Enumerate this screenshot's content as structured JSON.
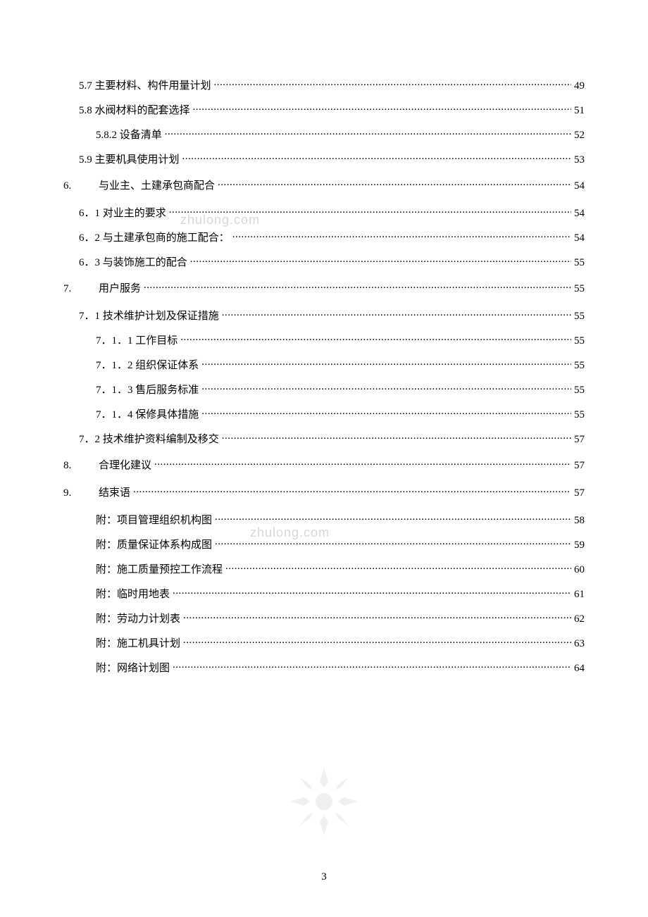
{
  "watermark": "zhulong.com",
  "pageNumber": "3",
  "toc": [
    {
      "level": 2,
      "label": "5.7 主要材料、构件用量计划 ",
      "page": "49"
    },
    {
      "level": 2,
      "label": "5.8 水阀材料的配套选择 ",
      "page": "51"
    },
    {
      "level": 3,
      "label": "5.8.2 设备清单 ",
      "page": "52"
    },
    {
      "level": 2,
      "label": "5.9 主要机具使用计划 ",
      "page": "53"
    },
    {
      "level": 1,
      "num": "6.",
      "label": "与业主、土建承包商配合",
      "page": "54"
    },
    {
      "level": 2,
      "label": "6．1 对业主的要求 ",
      "page": "54"
    },
    {
      "level": 2,
      "label": "6．2 与土建承包商的施工配合： ",
      "page": "54"
    },
    {
      "level": 2,
      "label": "6．3 与装饰施工的配合 ",
      "page": "55"
    },
    {
      "level": 1,
      "num": "7.",
      "label": "用户服务",
      "page": "55"
    },
    {
      "level": 2,
      "label": "7．1 技术维护计划及保证措施 ",
      "page": "55"
    },
    {
      "level": 3,
      "label": "7．1．1 工作目标 ",
      "page": "55"
    },
    {
      "level": 3,
      "label": "7．1．2 组织保证体系 ",
      "page": "55"
    },
    {
      "level": 3,
      "label": "7．1．3 售后服务标准 ",
      "page": "55"
    },
    {
      "level": 3,
      "label": "7．1．4 保修具体措施 ",
      "page": "55"
    },
    {
      "level": 2,
      "label": "7．2 技术维护资料编制及移交 ",
      "page": "57"
    },
    {
      "level": 1,
      "num": "8.",
      "label": "合理化建议",
      "page": "57"
    },
    {
      "level": 1,
      "num": "9.",
      "label": "结束语",
      "page": "57"
    },
    {
      "level": 3,
      "label": "附：项目管理组织机构图",
      "page": "58"
    },
    {
      "level": 3,
      "label": "附：质量保证体系构成图",
      "page": "59"
    },
    {
      "level": 3,
      "label": "附：施工质量预控工作流程",
      "page": "60"
    },
    {
      "level": 3,
      "label": "附：临时用地表",
      "page": "61"
    },
    {
      "level": 3,
      "label": "附：劳动力计划表",
      "page": "62"
    },
    {
      "level": 3,
      "label": "附：施工机具计划",
      "page": "63"
    },
    {
      "level": 3,
      "label": "附：网络计划图",
      "page": "64"
    }
  ]
}
